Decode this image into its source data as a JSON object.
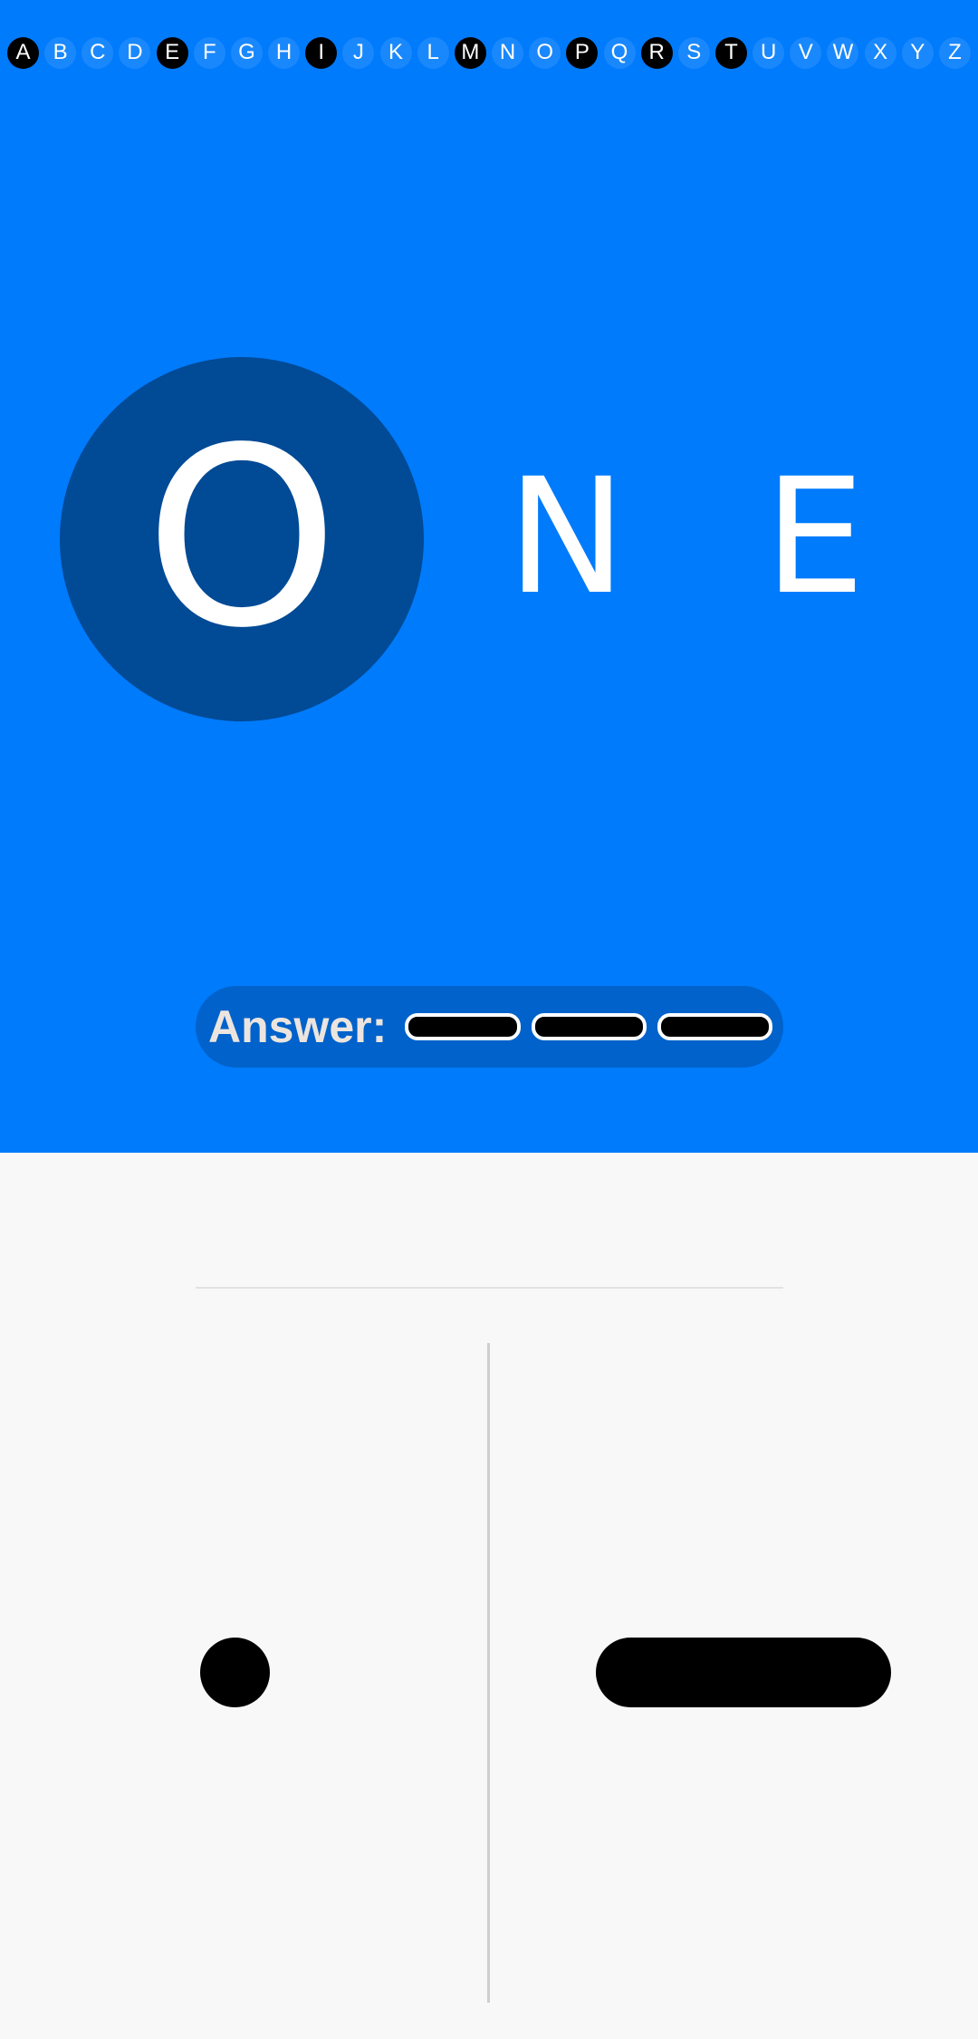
{
  "alphabet": [
    {
      "letter": "A",
      "active": true
    },
    {
      "letter": "B",
      "active": false
    },
    {
      "letter": "C",
      "active": false
    },
    {
      "letter": "D",
      "active": false
    },
    {
      "letter": "E",
      "active": true
    },
    {
      "letter": "F",
      "active": false
    },
    {
      "letter": "G",
      "active": false
    },
    {
      "letter": "H",
      "active": false
    },
    {
      "letter": "I",
      "active": true
    },
    {
      "letter": "J",
      "active": false
    },
    {
      "letter": "K",
      "active": false
    },
    {
      "letter": "L",
      "active": false
    },
    {
      "letter": "M",
      "active": true
    },
    {
      "letter": "N",
      "active": false
    },
    {
      "letter": "O",
      "active": false
    },
    {
      "letter": "P",
      "active": true
    },
    {
      "letter": "Q",
      "active": false
    },
    {
      "letter": "R",
      "active": true
    },
    {
      "letter": "S",
      "active": false
    },
    {
      "letter": "T",
      "active": true
    },
    {
      "letter": "U",
      "active": false
    },
    {
      "letter": "V",
      "active": false
    },
    {
      "letter": "W",
      "active": false
    },
    {
      "letter": "X",
      "active": false
    },
    {
      "letter": "Y",
      "active": false
    },
    {
      "letter": "Z",
      "active": false
    }
  ],
  "word": {
    "current_letter": "O",
    "letters": [
      "N",
      "E"
    ]
  },
  "answer": {
    "label": "Answer:",
    "symbols": [
      "dash",
      "dash",
      "dash"
    ]
  },
  "input": {
    "dot_icon": "dot-symbol",
    "dash_icon": "dash-symbol"
  },
  "colors": {
    "primary_background": "#007bfc",
    "current_letter_circle": "#004a96",
    "answer_pill": "#0062ca",
    "bottom_background": "#f8f8f8"
  }
}
